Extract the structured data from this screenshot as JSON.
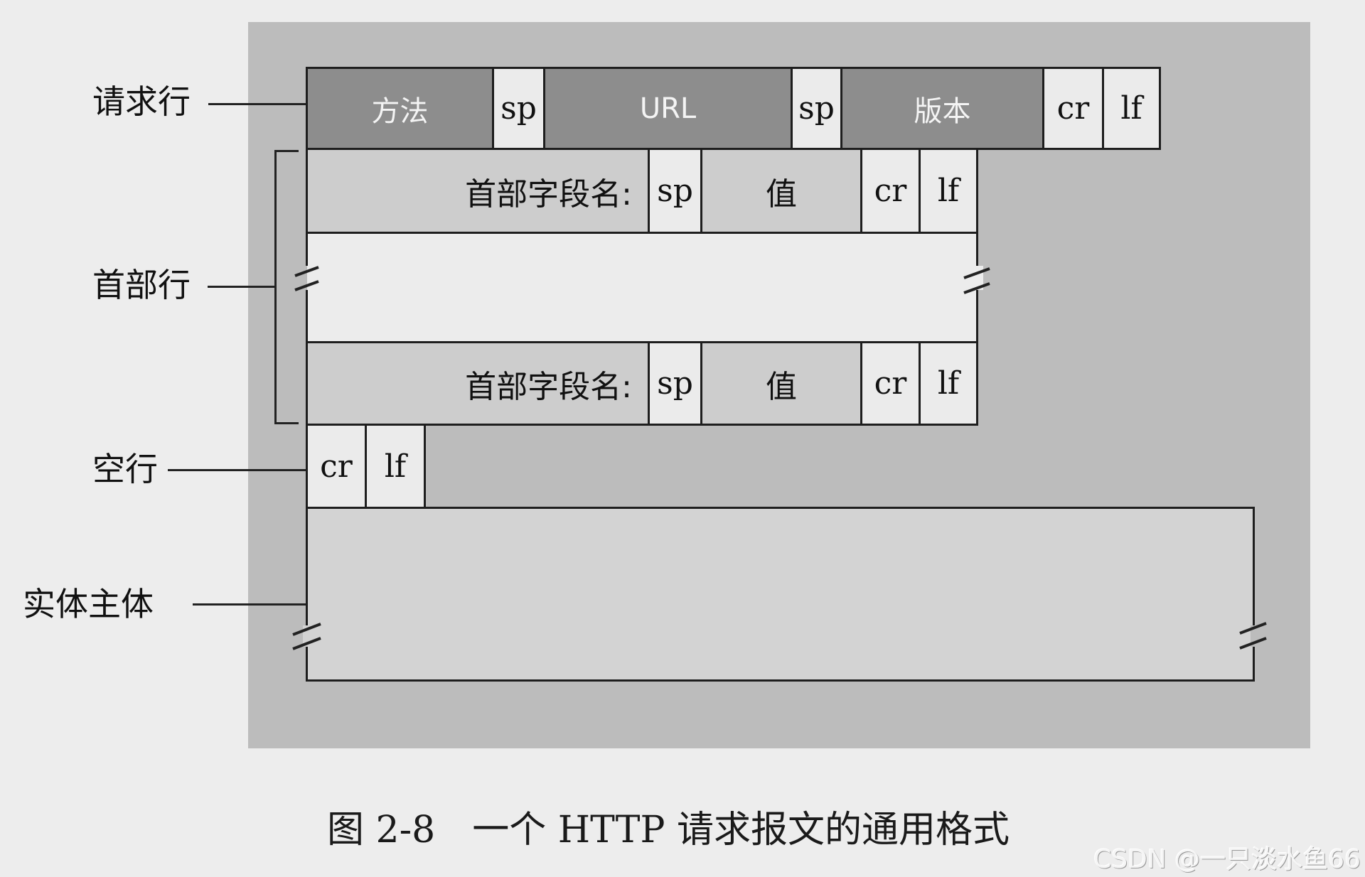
{
  "figure": {
    "caption": "图 2-8　一个 HTTP 请求报文的通用格式",
    "watermark": "CSDN @一只淡水鱼66"
  },
  "labels": {
    "request_line": "请求行",
    "header_lines": "首部行",
    "blank_line": "空行",
    "entity_body": "实体主体"
  },
  "request_line": {
    "cells": [
      {
        "id": "method",
        "text": "方法"
      },
      {
        "id": "sp1",
        "text": "sp"
      },
      {
        "id": "url",
        "text": "URL"
      },
      {
        "id": "sp2",
        "text": "sp"
      },
      {
        "id": "version",
        "text": "版本"
      },
      {
        "id": "cr",
        "text": "cr"
      },
      {
        "id": "lf",
        "text": "lf"
      }
    ]
  },
  "header_lines": {
    "rows": [
      {
        "name": "首部字段名:",
        "sp": "sp",
        "value": "值",
        "cr": "cr",
        "lf": "lf"
      },
      {
        "name": "首部字段名:",
        "sp": "sp",
        "value": "值",
        "cr": "cr",
        "lf": "lf"
      }
    ]
  },
  "blank_line": {
    "cr": "cr",
    "lf": "lf"
  },
  "entity_body": {
    "content": ""
  },
  "break_marks": {
    "symbol": "continuation-break"
  }
}
